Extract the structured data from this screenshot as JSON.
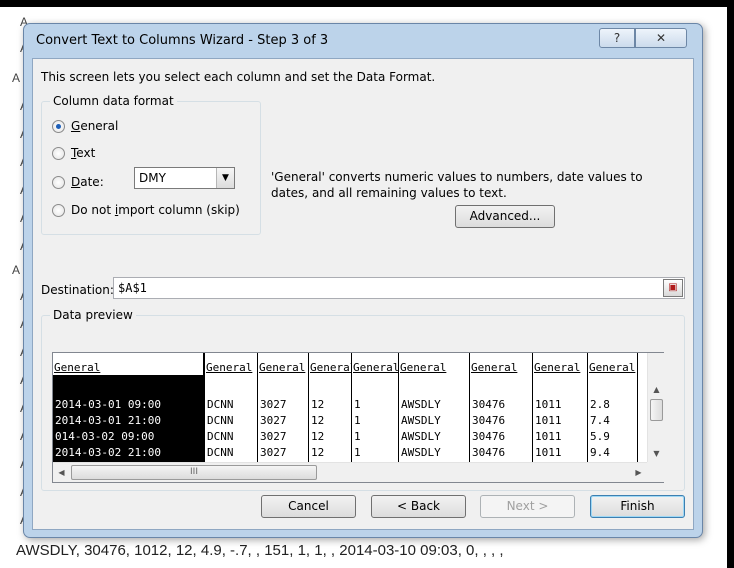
{
  "background": {
    "row_fragments": [
      "A",
      "A",
      "A",
      "A",
      "A",
      "A",
      "A",
      "A",
      "A",
      "A",
      "A",
      "A",
      "A",
      "A",
      "A",
      "A",
      "A",
      "A",
      "A"
    ],
    "bottom_line": "AWSDLY, 30476, 1012, 12, 4.9, -.7, , 151, 1, 1, , 2014-03-10 09:03, 0, , , ,"
  },
  "dialog": {
    "title": "Convert Text to Columns Wizard - Step 3 of 3",
    "help_icon": "?",
    "close_icon": "✕",
    "description": "This screen lets you select each column and set the Data Format.",
    "format_group": {
      "legend": "Column data format",
      "options": [
        {
          "label": "General",
          "accel": "G",
          "checked": true
        },
        {
          "label": "Text",
          "accel": "T",
          "checked": false
        },
        {
          "label": "Date:",
          "accel": "D",
          "checked": false
        },
        {
          "label": "Do not import column (skip)",
          "accel": "i",
          "checked": false
        }
      ],
      "date_value": "DMY"
    },
    "general_description": "'General' converts numeric values to numbers, date values to dates, and all remaining values to text.",
    "advanced_button": "Advanced...",
    "destination": {
      "label": "Destination:",
      "value": "$A$1"
    },
    "preview": {
      "legend": "Data preview",
      "columns": [
        {
          "header": "General",
          "rows": [
            "2014-03-01 09:00",
            "2014-03-01 21:00",
            "014-03-02 09:00",
            "2014-03-02 21:00"
          ]
        },
        {
          "header": "General",
          "rows": [
            "DCNN",
            "DCNN",
            "DCNN",
            "DCNN"
          ]
        },
        {
          "header": "General",
          "rows": [
            "3027",
            "3027",
            "3027",
            "3027"
          ]
        },
        {
          "header": "General",
          "rows": [
            "12",
            "12",
            "12",
            "12"
          ]
        },
        {
          "header": "General",
          "rows": [
            "1",
            "1",
            "1",
            "1"
          ]
        },
        {
          "header": "General",
          "rows": [
            "AWSDLY",
            "AWSDLY",
            "AWSDLY",
            "AWSDLY"
          ]
        },
        {
          "header": "General",
          "rows": [
            "30476",
            "30476",
            "30476",
            "30476"
          ]
        },
        {
          "header": "General",
          "rows": [
            "1011",
            "1011",
            "1011",
            "1011"
          ]
        },
        {
          "header": "General",
          "rows": [
            "2.8",
            "7.4",
            "5.9",
            "9.4"
          ]
        }
      ],
      "hscroll_grip": "III"
    },
    "buttons": {
      "cancel": "Cancel",
      "back": "< Back",
      "next": "Next >",
      "finish": "Finish"
    }
  }
}
